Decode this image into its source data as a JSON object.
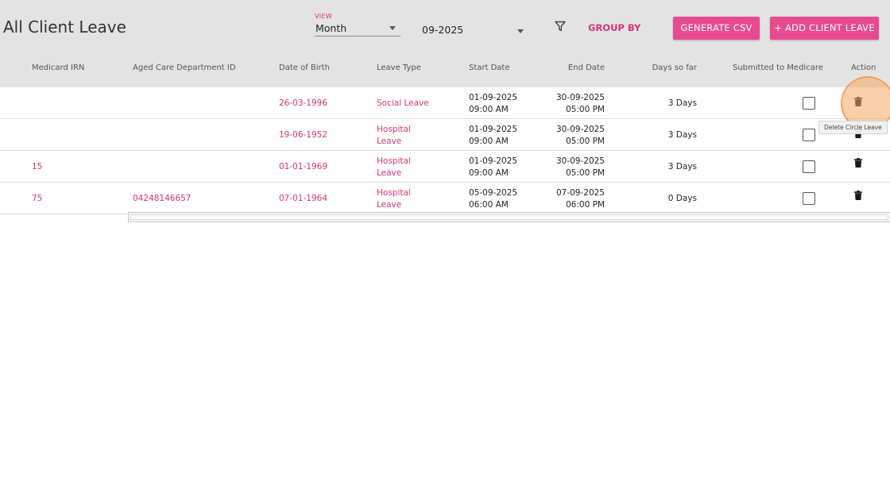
{
  "page": {
    "title": "All Client Leave"
  },
  "toolbar": {
    "view_label": "VIEW",
    "view_value": "Month",
    "month_value": "09-2025",
    "group_by_label": "GROUP BY",
    "generate_csv_label": "GENERATE CSV",
    "add_client_leave_label": "+ ADD CLIENT LEAVE"
  },
  "table": {
    "columns": {
      "medicard_irn": "Medicard IRN",
      "aged_care_id": "Aged Care Department ID",
      "dob": "Date of Birth",
      "leave_type": "Leave Type",
      "start_date": "Start Date",
      "end_date": "End Date",
      "days_so_far": "Days so far",
      "submitted": "Submitted to Medicare",
      "action": "Action"
    },
    "rows": [
      {
        "medicard_irn": "",
        "aged_care_id": "",
        "dob": "26-03-1996",
        "leave_type_1": "Social Leave",
        "leave_type_2": "",
        "start_date": "01-09-2025",
        "start_time": "09:00 AM",
        "end_date": "30-09-2025",
        "end_time": "05:00 PM",
        "days": "3 Days",
        "submitted": false
      },
      {
        "medicard_irn": "",
        "aged_care_id": "",
        "dob": "19-06-1952",
        "leave_type_1": "Hospital",
        "leave_type_2": "Leave",
        "start_date": "01-09-2025",
        "start_time": "09:00 AM",
        "end_date": "30-09-2025",
        "end_time": "05:00 PM",
        "days": "3 Days",
        "submitted": false
      },
      {
        "medicard_irn": "15",
        "aged_care_id": "",
        "dob": "01-01-1969",
        "leave_type_1": "Hospital",
        "leave_type_2": "Leave",
        "start_date": "01-09-2025",
        "start_time": "09:00 AM",
        "end_date": "30-09-2025",
        "end_time": "05:00 PM",
        "days": "3 Days",
        "submitted": false
      },
      {
        "medicard_irn": "75",
        "aged_care_id": "04248146657",
        "dob": "07-01-1964",
        "leave_type_1": "Hospital",
        "leave_type_2": "Leave",
        "start_date": "05-09-2025",
        "start_time": "06:00 AM",
        "end_date": "07-09-2025",
        "end_time": "06:00 PM",
        "days": "0 Days",
        "submitted": false
      }
    ]
  },
  "tooltip": {
    "text": "Delete Circle Leave"
  },
  "icons": {
    "filter": "filter-icon",
    "delete": "trash-icon",
    "dropdown": "caret-down-icon"
  },
  "colors": {
    "accent": "#d6337a",
    "button": "#e84a8f",
    "header_bg": "#e3e3e3"
  }
}
